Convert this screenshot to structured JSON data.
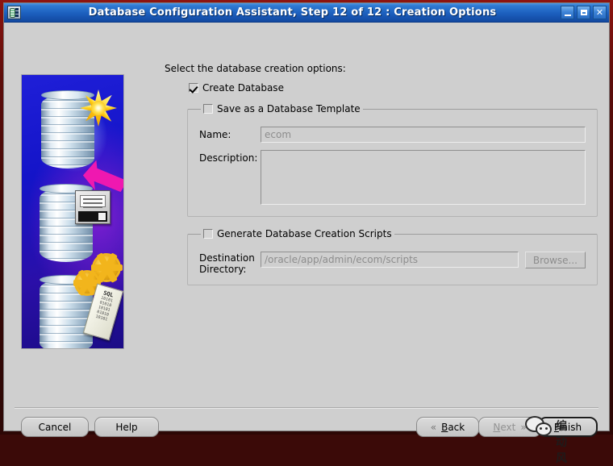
{
  "window": {
    "title": "Database Configuration Assistant, Step 12 of 12 : Creation Options",
    "icon": "database-app-icon",
    "buttons": {
      "minimize": "minimize-icon",
      "maximize": "maximize-icon",
      "close": "✕"
    }
  },
  "artwork": {
    "name": "dbca-creation-options-graphic",
    "elements": [
      "database-cylinder-with-star",
      "magenta-arrow",
      "database-cylinder-with-floppy-disk",
      "database-cylinder-with-gears",
      "sql-scroll"
    ],
    "scroll_label": "SQL",
    "scroll_bits": "10101\n01010\n10101\n01010",
    "background_color": "#1414c8",
    "accent_color": "#ef18b0"
  },
  "main": {
    "intro": "Select the database creation options:",
    "create_database": {
      "label": "Create Database",
      "checked": true
    },
    "save_template": {
      "label": "Save as a Database Template",
      "checked": false,
      "name_label": "Name:",
      "name_value": "ecom",
      "description_label": "Description:",
      "description_value": ""
    },
    "generate_scripts": {
      "label": "Generate Database Creation Scripts",
      "checked": false,
      "destination_label": "Destination\nDirectory:",
      "destination_label_line1": "Destination",
      "destination_label_line2": "Directory:",
      "destination_value": "/oracle/app/admin/ecom/scripts",
      "browse_label": "Browse...",
      "browse_enabled": false
    }
  },
  "buttons": {
    "cancel": "Cancel",
    "help": "Help",
    "back": {
      "label": "Back",
      "mnemonic": "B",
      "chevron": "«",
      "enabled": true
    },
    "next": {
      "label": "Next",
      "mnemonic": "N",
      "chevron": "»",
      "enabled": false
    },
    "finish": {
      "label": "Finish",
      "mnemonic": "F",
      "enabled": true,
      "default": true
    }
  },
  "overlay": {
    "watermark_text": "编动风",
    "watermark_icon": "chat-bubbles-icon"
  },
  "colors": {
    "titlebar": "#1c5fbe",
    "dialog_bg": "#cfcfcf",
    "frame": "#5d0d0a",
    "disabled_text": "#8d8d8d"
  }
}
